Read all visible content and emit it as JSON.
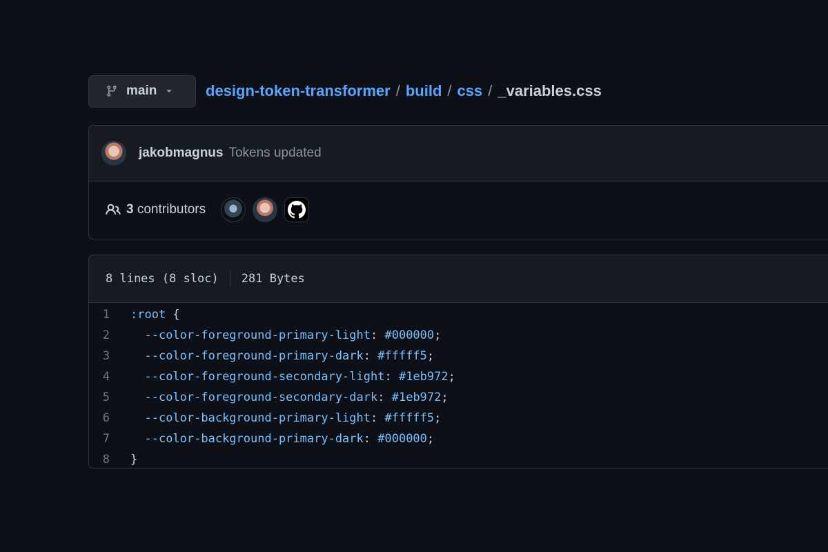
{
  "branch": {
    "name": "main",
    "icon": "git-branch-icon"
  },
  "breadcrumb": {
    "repo": "design-token-transformer",
    "dir1": "build",
    "dir2": "css",
    "file": "_variables.css",
    "separator": "/"
  },
  "commit": {
    "author": "jakobmagnus",
    "message": "Tokens updated"
  },
  "contributors": {
    "count": "3",
    "label": "contributors",
    "icon": "people-icon"
  },
  "file_info": {
    "lines": "8 lines (8 sloc)",
    "size": "281 Bytes"
  },
  "code": [
    {
      "num": "1",
      "indent": "",
      "name": ":root",
      "colon": "",
      "value": "",
      "tail": " {"
    },
    {
      "num": "2",
      "indent": "  ",
      "name": "--color-foreground-primary-light",
      "colon": ":",
      "value": " #000000",
      "tail": ";"
    },
    {
      "num": "3",
      "indent": "  ",
      "name": "--color-foreground-primary-dark",
      "colon": ":",
      "value": " #fffff5",
      "tail": ";"
    },
    {
      "num": "4",
      "indent": "  ",
      "name": "--color-foreground-secondary-light",
      "colon": ":",
      "value": " #1eb972",
      "tail": ";"
    },
    {
      "num": "5",
      "indent": "  ",
      "name": "--color-foreground-secondary-dark",
      "colon": ":",
      "value": " #1eb972",
      "tail": ";"
    },
    {
      "num": "6",
      "indent": "  ",
      "name": "--color-background-primary-light",
      "colon": ":",
      "value": " #fffff5",
      "tail": ";"
    },
    {
      "num": "7",
      "indent": "  ",
      "name": "--color-background-primary-dark",
      "colon": ":",
      "value": " #000000",
      "tail": ";"
    },
    {
      "num": "8",
      "indent": "",
      "name": "",
      "colon": "",
      "value": "",
      "tail": "}"
    }
  ],
  "colors": {
    "background": "#0d1117",
    "panel": "#161b22",
    "border": "#30363d",
    "link": "#58a6ff",
    "text": "#c9d1d9",
    "muted": "#8b949e"
  }
}
